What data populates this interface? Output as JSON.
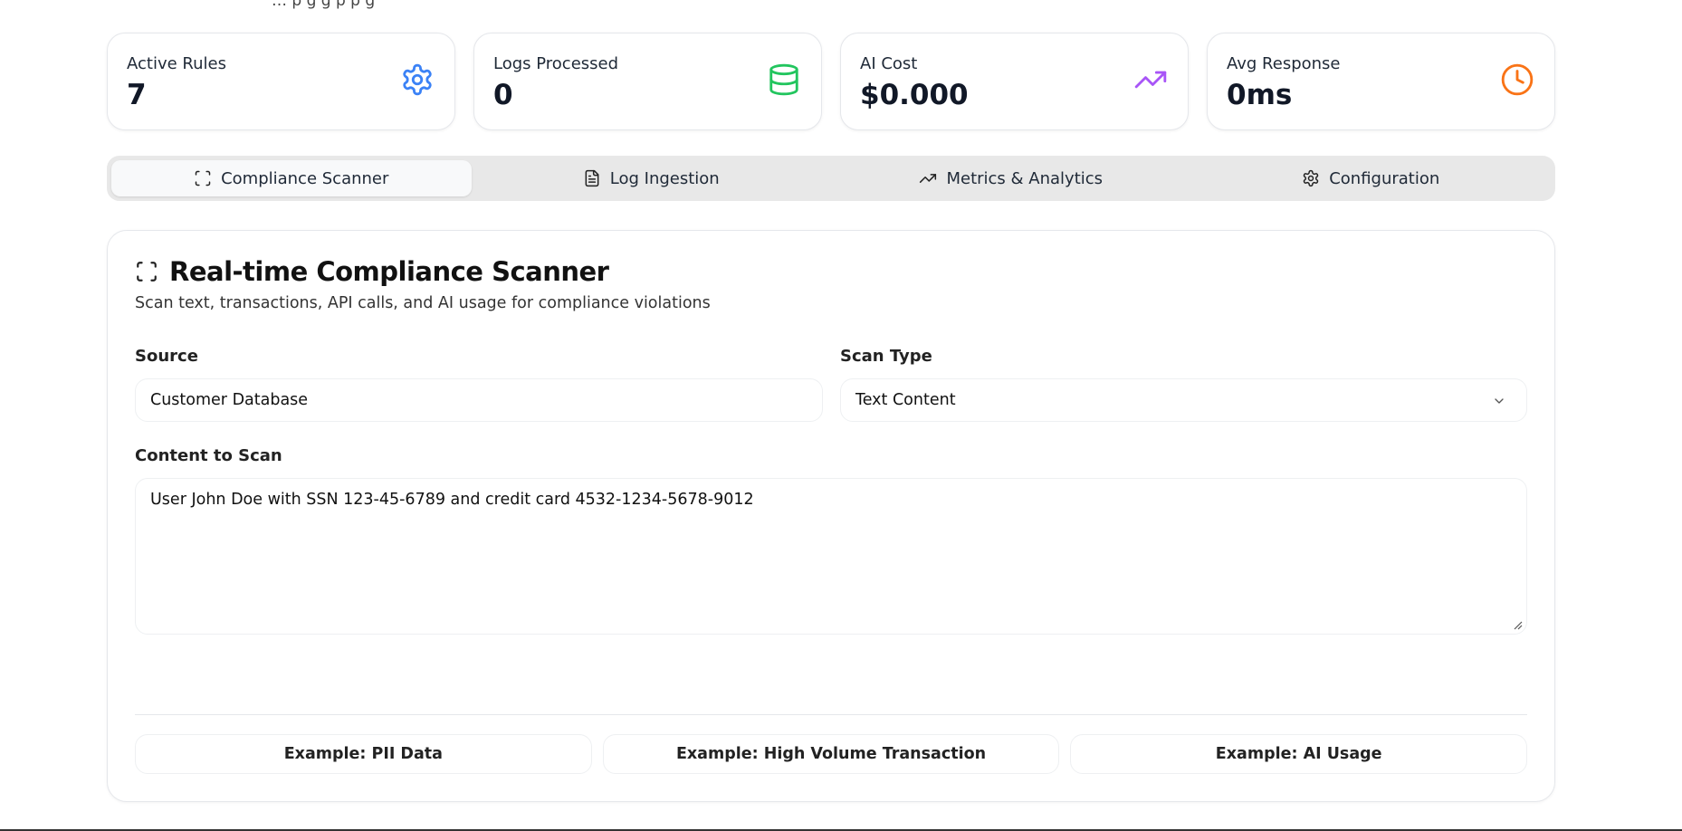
{
  "header": {
    "cut_text": "…   p  g g    p                      p              g"
  },
  "stats": [
    {
      "label": "Active Rules",
      "value": "7",
      "icon": "gear-icon",
      "color": "#3b82f6"
    },
    {
      "label": "Logs Processed",
      "value": "0",
      "icon": "database-icon",
      "color": "#22c55e"
    },
    {
      "label": "AI Cost",
      "value": "$0.000",
      "icon": "trending-up-icon",
      "color": "#a855f7"
    },
    {
      "label": "Avg Response",
      "value": "0ms",
      "icon": "clock-icon",
      "color": "#f97316"
    }
  ],
  "tabs": [
    {
      "label": "Compliance Scanner",
      "icon": "scan-icon",
      "active": true
    },
    {
      "label": "Log Ingestion",
      "icon": "document-icon",
      "active": false
    },
    {
      "label": "Metrics & Analytics",
      "icon": "trending-up-icon",
      "active": false
    },
    {
      "label": "Configuration",
      "icon": "gear-icon",
      "active": false
    }
  ],
  "scanner": {
    "title": "Real-time Compliance Scanner",
    "description": "Scan text, transactions, API calls, and AI usage for compliance violations",
    "source_label": "Source",
    "source_value": "Customer Database",
    "scan_type_label": "Scan Type",
    "scan_type_value": "Text Content",
    "content_label": "Content to Scan",
    "content_value": "User John Doe with SSN 123-45-6789 and credit card 4532-1234-5678-9012",
    "examples": [
      "Example: PII Data",
      "Example: High Volume Transaction",
      "Example: AI Usage"
    ]
  }
}
